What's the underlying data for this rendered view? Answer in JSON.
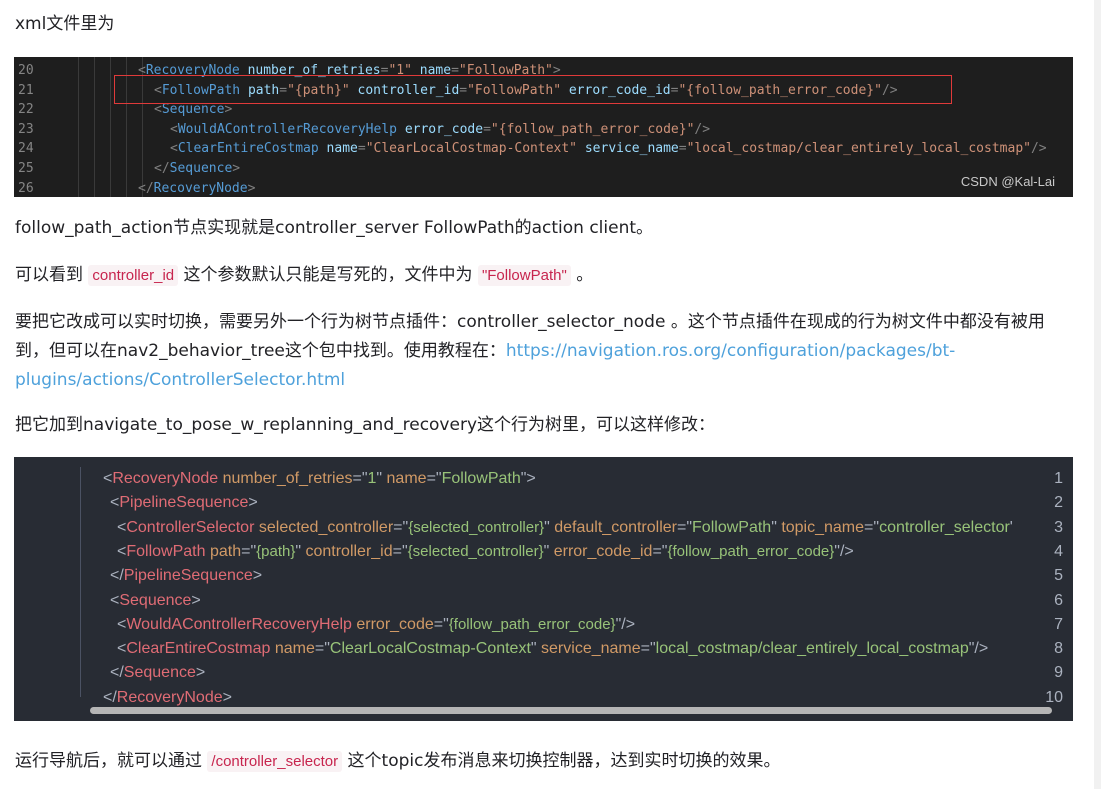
{
  "p1": "xml文件里为",
  "screenshot": {
    "watermark": "CSDN @Kal-Lai",
    "lines": [
      {
        "n": "20",
        "parts": [
          [
            "t",
            "<"
          ],
          [
            "tag",
            "RecoveryNode"
          ],
          [
            "t",
            " "
          ],
          [
            "attr",
            "number_of_retries"
          ],
          [
            "t",
            "="
          ],
          [
            "str",
            "\"1\""
          ],
          [
            "t",
            " "
          ],
          [
            "attr",
            "name"
          ],
          [
            "t",
            "="
          ],
          [
            "str",
            "\"FollowPath\""
          ],
          [
            "t",
            ">"
          ]
        ]
      },
      {
        "n": "21",
        "parts": [
          [
            "t",
            "<"
          ],
          [
            "tag",
            "FollowPath"
          ],
          [
            "t",
            " "
          ],
          [
            "attr",
            "path"
          ],
          [
            "t",
            "="
          ],
          [
            "str",
            "\"{path}\""
          ],
          [
            "t",
            " "
          ],
          [
            "attr",
            "controller_id"
          ],
          [
            "t",
            "="
          ],
          [
            "str",
            "\"FollowPath\""
          ],
          [
            "t",
            " "
          ],
          [
            "attr",
            "error_code_id"
          ],
          [
            "t",
            "="
          ],
          [
            "str",
            "\"{follow_path_error_code}\""
          ],
          [
            "t",
            "/>"
          ]
        ]
      },
      {
        "n": "22",
        "parts": [
          [
            "t",
            "<"
          ],
          [
            "tag",
            "Sequence"
          ],
          [
            "t",
            ">"
          ]
        ]
      },
      {
        "n": "23",
        "parts": [
          [
            "t",
            "<"
          ],
          [
            "tag",
            "WouldAControllerRecoveryHelp"
          ],
          [
            "t",
            " "
          ],
          [
            "attr",
            "error_code"
          ],
          [
            "t",
            "="
          ],
          [
            "str",
            "\"{follow_path_error_code}\""
          ],
          [
            "t",
            "/>"
          ]
        ]
      },
      {
        "n": "24",
        "parts": [
          [
            "t",
            "<"
          ],
          [
            "tag",
            "ClearEntireCostmap"
          ],
          [
            "t",
            " "
          ],
          [
            "attr",
            "name"
          ],
          [
            "t",
            "="
          ],
          [
            "str",
            "\"ClearLocalCostmap-Context\""
          ],
          [
            "t",
            " "
          ],
          [
            "attr",
            "service_name"
          ],
          [
            "t",
            "="
          ],
          [
            "str",
            "\"local_costmap/clear_entirely_local_costmap\""
          ],
          [
            "t",
            "/>"
          ]
        ]
      },
      {
        "n": "25",
        "parts": [
          [
            "t",
            "</"
          ],
          [
            "tag",
            "Sequence"
          ],
          [
            "t",
            ">"
          ]
        ]
      },
      {
        "n": "26",
        "parts": [
          [
            "t",
            "</"
          ],
          [
            "tag",
            "RecoveryNode"
          ],
          [
            "t",
            ">"
          ]
        ]
      }
    ]
  },
  "p2": "follow_path_action节点实现就是controller_server FollowPath的action client。",
  "p3": {
    "a": "可以看到 ",
    "code1": "controller_id",
    "b": " 这个参数默认只能是写死的，文件中为 ",
    "code2": "\"FollowPath\"",
    "c": " 。"
  },
  "p4": {
    "line1": "要把它改成可以实时切换，需要另外一个行为树节点插件：controller_selector_node 。这个节点插件在现成的行为树文件中都没有被用",
    "line2a": "到，但可以在nav2_behavior_tree这个包中找到。使用教程在：",
    "link1": "https://navigation.ros.org/configuration/packages/bt-",
    "link2": "plugins/actions/ControllerSelector.html"
  },
  "p5": "把它加到navigate_to_pose_w_replanning_and_recovery这个行为树里，可以这样修改：",
  "code": {
    "lines": [
      {
        "n": "1",
        "parts": [
          [
            "p",
            "<"
          ],
          [
            "tag",
            "RecoveryNode"
          ],
          [
            "p",
            " "
          ],
          [
            "attr",
            "number_of_retries"
          ],
          [
            "p",
            "=\""
          ],
          [
            "val",
            "1"
          ],
          [
            "p",
            "\" "
          ],
          [
            "attr",
            "name"
          ],
          [
            "p",
            "=\""
          ],
          [
            "val",
            "FollowPath"
          ],
          [
            "p",
            "\">"
          ]
        ]
      },
      {
        "n": "2",
        "parts": [
          [
            "p",
            "<"
          ],
          [
            "tag",
            "PipelineSequence"
          ],
          [
            "p",
            ">"
          ]
        ]
      },
      {
        "n": "3",
        "parts": [
          [
            "p",
            "<"
          ],
          [
            "tag",
            "ControllerSelector"
          ],
          [
            "p",
            " "
          ],
          [
            "attr",
            "selected_controller"
          ],
          [
            "p",
            "=\""
          ],
          [
            "tm",
            "{selected_controller}"
          ],
          [
            "p",
            "\" "
          ],
          [
            "attr",
            "default_controller"
          ],
          [
            "p",
            "=\""
          ],
          [
            "val",
            "FollowPath"
          ],
          [
            "p",
            "\" "
          ],
          [
            "attr",
            "topic_name"
          ],
          [
            "p",
            "=\""
          ],
          [
            "val",
            "controller_selector"
          ],
          [
            "p",
            "'"
          ]
        ]
      },
      {
        "n": "4",
        "parts": [
          [
            "p",
            "<"
          ],
          [
            "tag",
            "FollowPath"
          ],
          [
            "p",
            " "
          ],
          [
            "attr",
            "path"
          ],
          [
            "p",
            "=\""
          ],
          [
            "tm",
            "{path}"
          ],
          [
            "p",
            "\" "
          ],
          [
            "attr",
            "controller_id"
          ],
          [
            "p",
            "=\""
          ],
          [
            "tm",
            "{selected_controller}"
          ],
          [
            "p",
            "\" "
          ],
          [
            "attr",
            "error_code_id"
          ],
          [
            "p",
            "=\""
          ],
          [
            "tm",
            "{follow_path_error_code}"
          ],
          [
            "p",
            "\"/>"
          ]
        ]
      },
      {
        "n": "5",
        "parts": [
          [
            "p",
            "</"
          ],
          [
            "tag",
            "PipelineSequence"
          ],
          [
            "p",
            ">"
          ]
        ]
      },
      {
        "n": "6",
        "parts": [
          [
            "p",
            "<"
          ],
          [
            "tag",
            "Sequence"
          ],
          [
            "p",
            ">"
          ]
        ]
      },
      {
        "n": "7",
        "parts": [
          [
            "p",
            "<"
          ],
          [
            "tag",
            "WouldAControllerRecoveryHelp"
          ],
          [
            "p",
            " "
          ],
          [
            "attr",
            "error_code"
          ],
          [
            "p",
            "=\""
          ],
          [
            "tm",
            "{follow_path_error_code}"
          ],
          [
            "p",
            "\"/>"
          ]
        ]
      },
      {
        "n": "8",
        "parts": [
          [
            "p",
            "<"
          ],
          [
            "tag",
            "ClearEntireCostmap"
          ],
          [
            "p",
            " "
          ],
          [
            "attr",
            "name"
          ],
          [
            "p",
            "=\""
          ],
          [
            "val",
            "ClearLocalCostmap-Context"
          ],
          [
            "p",
            "\" "
          ],
          [
            "attr",
            "service_name"
          ],
          [
            "p",
            "=\""
          ],
          [
            "val",
            "local_costmap/clear_entirely_local_costmap"
          ],
          [
            "p",
            "\"/>"
          ]
        ]
      },
      {
        "n": "9",
        "parts": [
          [
            "p",
            "</"
          ],
          [
            "tag",
            "Sequence"
          ],
          [
            "p",
            ">"
          ]
        ]
      },
      {
        "n": "10",
        "parts": [
          [
            "p",
            "</"
          ],
          [
            "tag",
            "RecoveryNode"
          ],
          [
            "p",
            ">"
          ]
        ]
      }
    ]
  },
  "p6": {
    "a": "运行导航后，就可以通过 ",
    "code": "/controller_selector",
    "b": " 这个topic发布消息来切换控制器，达到实时切换的效果。"
  }
}
